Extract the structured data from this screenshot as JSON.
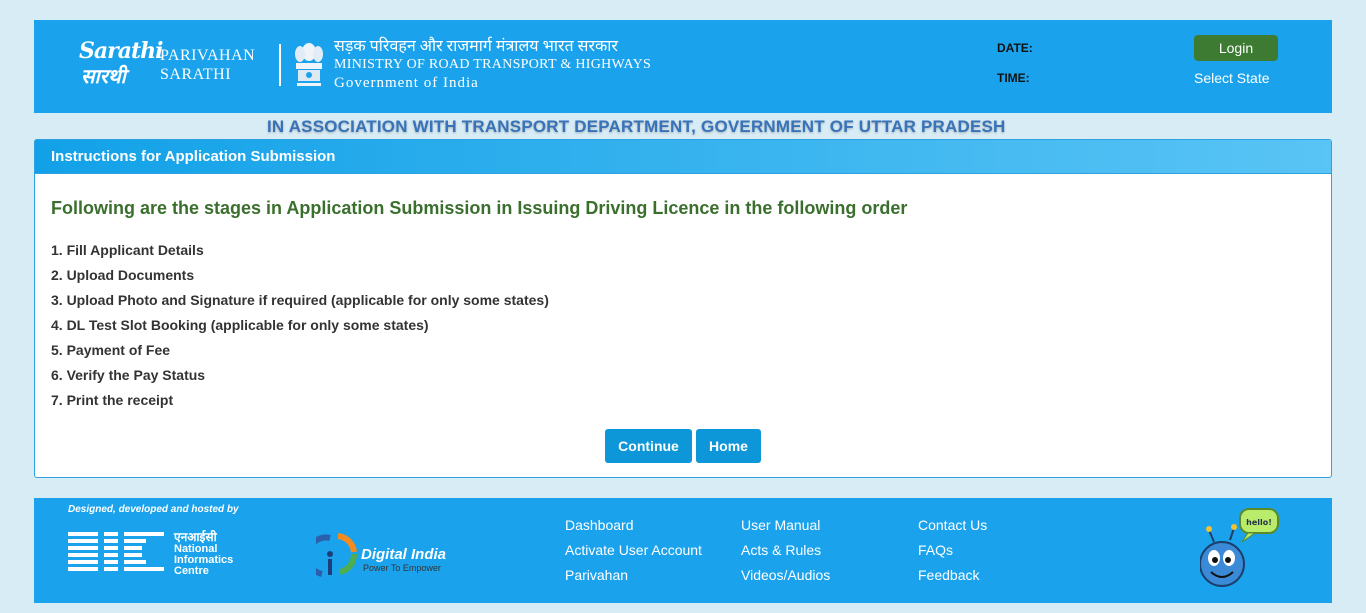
{
  "header": {
    "logo_en": "Sarathi",
    "logo_hi": "सारथी",
    "parivahan_line1": "PARIVAHAN",
    "parivahan_line2": "SARATHI",
    "ministry_hi": "सड़क परिवहन और राजमार्ग मंत्रालय भारत सरकार",
    "ministry_en": "MINISTRY OF ROAD TRANSPORT & HIGHWAYS",
    "ministry_gov": "Government of India",
    "date_label": "DATE:",
    "time_label": "TIME:",
    "login_label": "Login",
    "select_state_label": "Select State"
  },
  "association": "IN ASSOCIATION WITH TRANSPORT DEPARTMENT, GOVERNMENT OF UTTAR PRADESH",
  "panel": {
    "heading": "Instructions for Application Submission",
    "title": "Following are the stages in Application Submission in Issuing Driving Licence in the following order",
    "steps": [
      "1. Fill Applicant Details",
      "2. Upload Documents",
      "3. Upload Photo and Signature if required (applicable for only some states)",
      "4. DL Test Slot Booking (applicable for only some states)",
      "5. Payment of Fee",
      "6. Verify the Pay Status",
      "7. Print the receipt"
    ],
    "continue_label": "Continue",
    "home_label": "Home"
  },
  "footer": {
    "designed_by": "Designed, developed and hosted by",
    "nic_hi": "एनआईसी",
    "nic_line1": "National",
    "nic_line2": "Informatics",
    "nic_line3": "Centre",
    "digital_india": "Digital India",
    "digital_india_tagline": "Power To Empower",
    "mascot_bubble": "hello!",
    "links_col1": [
      "Dashboard",
      "Activate User Account",
      "Parivahan"
    ],
    "links_col2": [
      "User Manual",
      "Acts & Rules",
      "Videos/Audios"
    ],
    "links_col3": [
      "Contact Us",
      "FAQs",
      "Feedback"
    ]
  },
  "colors": {
    "header_blue": "#1aa3ec",
    "login_green": "#3d7b33",
    "title_green": "#3b6f2e",
    "association_blue": "#3872b8",
    "button_blue": "#0e97d8",
    "page_bg": "#d8ecf6"
  },
  "icons": {
    "emblem": "national-emblem-icon",
    "nic": "nic-logo-icon",
    "digital_india": "digital-india-logo-icon",
    "mascot": "mascot-hello-icon"
  }
}
